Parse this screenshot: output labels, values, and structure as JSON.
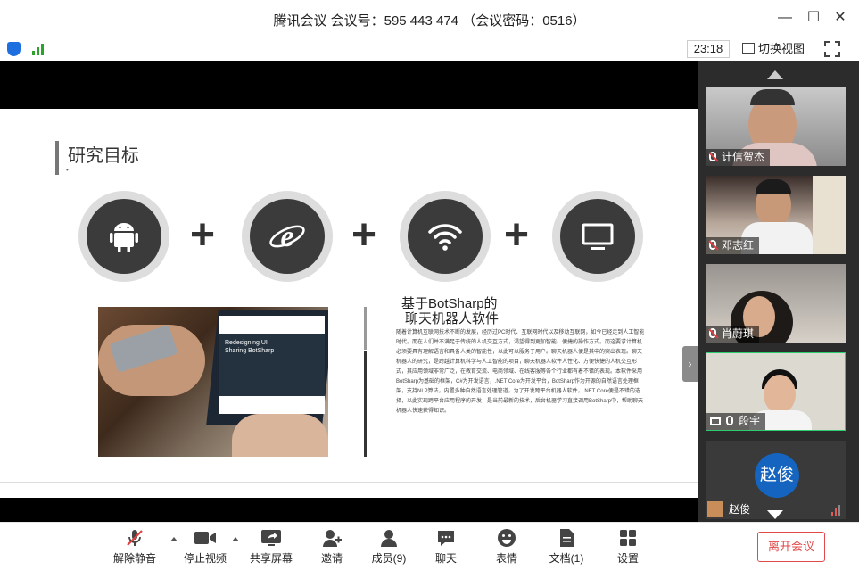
{
  "window": {
    "title": "腾讯会议 会议号：595 443 474 （会议密码：0516）",
    "minimize": "—",
    "maximize": "☐",
    "close": "✕"
  },
  "status": {
    "time": "23:18",
    "view_toggle": "切换视图"
  },
  "slide": {
    "heading": "研究目标",
    "dot": "•",
    "plus": "+",
    "icons": [
      "android-icon",
      "ie-icon",
      "wifi-icon",
      "monitor-icon"
    ],
    "photo_screen_text": "Redesigning UI Sharing BotSharp",
    "point_title_line1": "基于BotSharp的",
    "point_title_line2": "聊天机器人软件",
    "point_body": "随着计算机互联网技术不断的发展，经历过PC时代、互联网时代以及移动互联网，如今已经走到人工智能时代。而在人们并不满足于传统的人机交互方式，渴望得到更加智能、便捷的操作方式。而这要求计算机必须要具有理解语言和具备人类的智能性，以此可以服务于用户。聊天机器人便是其中的突出表现。聊天机器人的研究，是跨越计算机科学与人工智能的项目，聊天机器人软件人性化、方便快捷的人机交互形式，其应用领域非常广泛，在教育交流、电商领域、在线客服等各个行业都有着不错的表现。本软件采用BotSharp为基础的框架，C#为开发语言，.NET Core为开发平台，BotSharp作为开源的自然语言处理框架，支持NLP算法，内置多种自然语言处理管道，为了开发跨平台机器人软件，.NET Core便是不错的选择，以此实现跨平台应用程序的开发，是当前最新的技术，后台机器学习直接调用BotSharp中，帮助聊天机器人快速获得知识。"
  },
  "sidebar": {
    "participants": [
      {
        "name": "计信贺杰",
        "mic": "muted"
      },
      {
        "name": "邓志红",
        "mic": "muted"
      },
      {
        "name": "肖蔚琪",
        "mic": "muted"
      },
      {
        "name": "段宇",
        "mic": "on"
      },
      {
        "name": "赵俊",
        "mic": "on",
        "avatar_text": "赵俊"
      }
    ]
  },
  "toolbar": {
    "unmute": "解除静音",
    "stop_video": "停止视频",
    "share_screen": "共享屏幕",
    "invite": "邀请",
    "members": "成员(9)",
    "chat": "聊天",
    "emoji": "表情",
    "docs": "文档(1)",
    "settings": "设置",
    "leave": "离开会议"
  },
  "colors": {
    "accent_red": "#e04a4a",
    "active_border": "#2ecc71",
    "avatar_blue": "#1565c0"
  }
}
